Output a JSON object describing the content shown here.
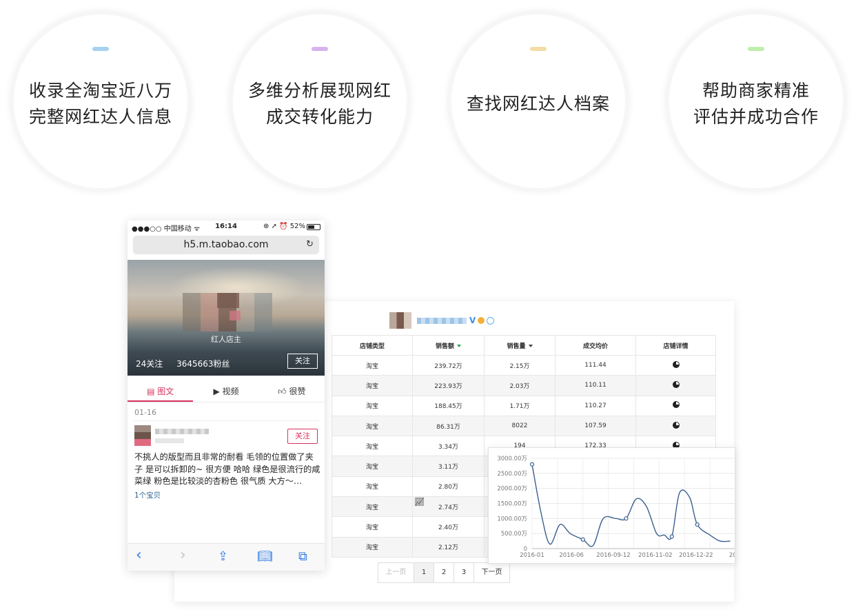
{
  "features": [
    {
      "lines": [
        "收录全淘宝近八万",
        "完整网红达人信息"
      ],
      "accent": "#a6d2f0"
    },
    {
      "lines": [
        "多维分析展现网红",
        "成交转化能力"
      ],
      "accent": "#d6b4ef"
    },
    {
      "lines": [
        "查找网红达人档案"
      ],
      "accent": "#f3dca6"
    },
    {
      "lines": [
        "帮助商家精准",
        "评估并成功合作"
      ],
      "accent": "#bfeeab"
    }
  ],
  "phone": {
    "status": {
      "carrier": "●●●○○ 中国移动 ᯤ",
      "time": "16:14",
      "right": "⊕ ➚ ⏰ 52%"
    },
    "url": "h5.m.taobao.com",
    "reload_icon": "reload-icon",
    "hero": {
      "shop_name": "红人店主",
      "following": "24关注",
      "fans": "3645663粉丝",
      "follow_label": "关注"
    },
    "tabs": [
      {
        "label": "图文",
        "icon": "document-icon",
        "active": true
      },
      {
        "label": "视频",
        "icon": "video-icon",
        "active": false
      },
      {
        "label": "很赞",
        "icon": "thumbs-up-icon",
        "active": false
      }
    ],
    "post": {
      "date": "01-16",
      "follow_label": "关注",
      "text": "不挑人的版型而且非常的耐看 毛领的位置做了夹子 是可以拆卸的~ 很方便 哈哈 绿色是很流行的咸菜绿 粉色是比较淡的杏粉色 很气质 大方～…",
      "items": "1个宝贝"
    },
    "toolbar": [
      "back-icon",
      "forward-icon",
      "share-icon",
      "bookmarks-icon",
      "tabs-icon"
    ]
  },
  "table": {
    "headers": [
      "店铺类型",
      "销售额",
      "销售量",
      "成交均价",
      "店铺详情"
    ],
    "rows": [
      [
        "淘宝",
        "239.72万",
        "2.15万",
        "111.44"
      ],
      [
        "淘宝",
        "223.93万",
        "2.03万",
        "110.11"
      ],
      [
        "淘宝",
        "188.45万",
        "1.71万",
        "110.27"
      ],
      [
        "淘宝",
        "86.31万",
        "8022",
        "107.59"
      ],
      [
        "淘宝",
        "3.34万",
        "194",
        "172.33"
      ],
      [
        "淘宝",
        "3.11万",
        "",
        ""
      ],
      [
        "淘宝",
        "2.80万",
        "",
        ""
      ],
      [
        "淘宝",
        "2.74万",
        "",
        ""
      ],
      [
        "淘宝",
        "2.40万",
        "",
        ""
      ],
      [
        "淘宝",
        "2.12万",
        "",
        ""
      ]
    ]
  },
  "pager": {
    "prev": "上一页",
    "pages": [
      "1",
      "2",
      "3"
    ],
    "next": "下一页",
    "current": "1"
  },
  "chart_data": {
    "type": "line",
    "title": "",
    "xlabel": "",
    "ylabel": "",
    "y_ticks": [
      "0",
      "500.00万",
      "1000.00万",
      "1500.00万",
      "2000.00万",
      "2500.00万",
      "3000.00万"
    ],
    "x_ticks": [
      "2016-01",
      "2016-06",
      "2016-09-12",
      "2016-11-02",
      "2016-12-22",
      "20"
    ],
    "ylim": [
      0,
      3000
    ],
    "y_unit": "万",
    "grid": true,
    "line_color": "#3a5f8f",
    "points": [
      [
        0,
        2800
      ],
      [
        0.35,
        1200
      ],
      [
        0.7,
        150
      ],
      [
        1.1,
        800
      ],
      [
        1.5,
        500
      ],
      [
        2.0,
        300
      ],
      [
        2.4,
        100
      ],
      [
        2.8,
        1000
      ],
      [
        3.3,
        1000
      ],
      [
        3.7,
        1000
      ],
      [
        4.1,
        1650
      ],
      [
        4.5,
        1400
      ],
      [
        4.9,
        500
      ],
      [
        5.2,
        450
      ],
      [
        5.5,
        400
      ],
      [
        5.8,
        1850
      ],
      [
        6.2,
        1700
      ],
      [
        6.5,
        800
      ],
      [
        7.0,
        450
      ],
      [
        7.4,
        250
      ],
      [
        7.8,
        250
      ]
    ],
    "marker_indices": [
      0,
      5,
      9,
      14,
      17
    ]
  }
}
